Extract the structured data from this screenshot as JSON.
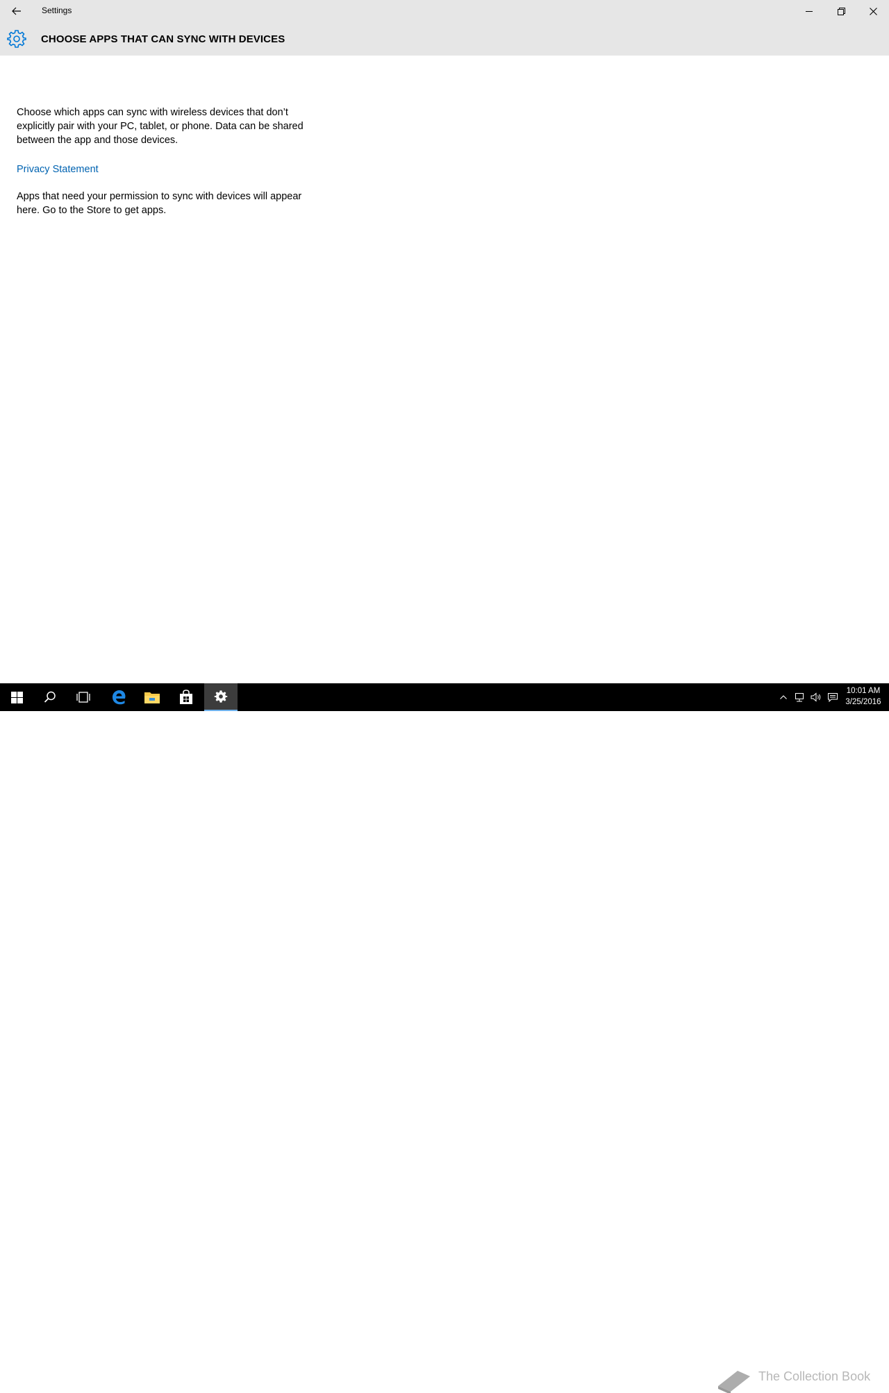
{
  "window": {
    "app_title": "Settings",
    "page_title": "CHOOSE APPS THAT CAN SYNC WITH DEVICES",
    "icons": {
      "back": "back-arrow-icon",
      "minimize": "minimize-icon",
      "restore": "restore-icon",
      "close": "close-icon",
      "header": "gear-icon"
    }
  },
  "content": {
    "description": "Choose which apps can sync with wireless devices that don’t explicitly pair with your PC, tablet, or phone. Data can be shared between the app and those devices.",
    "privacy_link": "Privacy Statement",
    "empty_state": "Apps that need your permission to sync with devices will appear here. Go to the Store to get apps."
  },
  "taskbar": {
    "items": [
      "start",
      "search",
      "task-view",
      "edge",
      "file-explorer",
      "store",
      "settings"
    ],
    "active_item": "settings",
    "clock_time": "10:01 AM",
    "clock_date": "3/25/2016"
  },
  "watermark": {
    "text": "The Collection Book"
  },
  "colors": {
    "accent": "#0063b1",
    "titlebar": "#e6e6e6",
    "taskbar": "#000000",
    "active_indicator": "#6fb2ec"
  }
}
